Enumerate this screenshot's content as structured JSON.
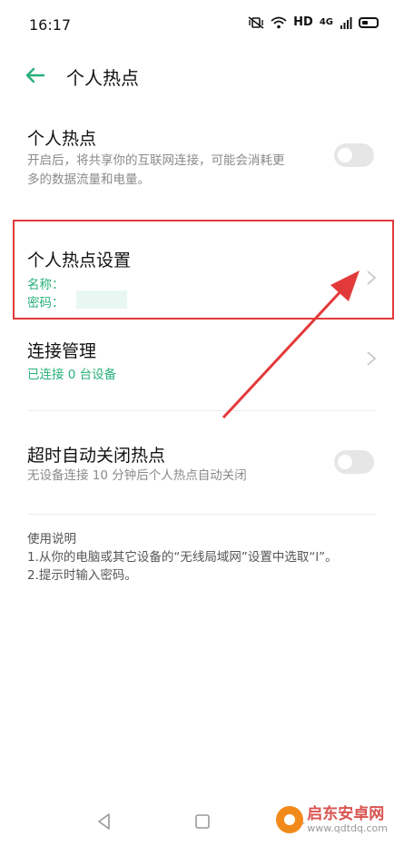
{
  "status": {
    "time": "16:17",
    "hd": "HD",
    "network": "4G"
  },
  "header": {
    "title": "个人热点"
  },
  "hotspot_toggle": {
    "title": "个人热点",
    "desc_line1": "开启后，将共享你的互联网连接，可能会消耗更",
    "desc_line2": "多的数据流量和电量。",
    "enabled": false
  },
  "hotspot_settings": {
    "title": "个人热点设置",
    "name_label": "名称：",
    "password_label": "密码："
  },
  "connection_mgmt": {
    "title": "连接管理",
    "status": "已连接 0 台设备"
  },
  "auto_off": {
    "title": "超时自动关闭热点",
    "desc": "无设备连接 10 分钟后个人热点自动关闭",
    "enabled": false
  },
  "instructions": {
    "title": "使用说明",
    "line1": "1.从你的电脑或其它设备的“无线局域网”设置中选取“l”。",
    "line2": "2.提示时输入密码。"
  },
  "watermark": {
    "name": "启东安卓网",
    "url": "www.qdtdq.com"
  },
  "colors": {
    "accent": "#27b07a",
    "highlight_box": "#e23a3a",
    "arrow": "#e23a3a"
  }
}
